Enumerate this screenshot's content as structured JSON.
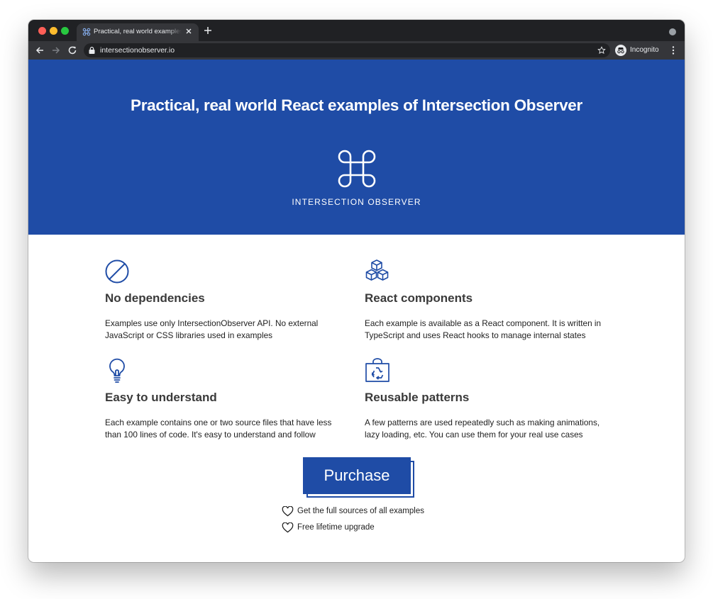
{
  "browser": {
    "tab_title": "Practical, real world examples of Intersection Observer",
    "url": "intersectionobserver.io",
    "profile_label": "Incognito"
  },
  "hero": {
    "title": "Practical, real world React examples of Intersection Observer",
    "logo_text": "INTERSECTION OBSERVER"
  },
  "features": [
    {
      "icon": "no-dependencies-icon",
      "title": "No dependencies",
      "description": "Examples use only IntersectionObserver API. No external JavaScript or CSS libraries used in examples"
    },
    {
      "icon": "react-components-icon",
      "title": "React components",
      "description": "Each example is available as a React component. It is written in TypeScript and uses React hooks to manage internal states"
    },
    {
      "icon": "lightbulb-icon",
      "title": "Easy to understand",
      "description": "Each example contains one or two source files that have less than 100 lines of code. It's easy to understand and follow"
    },
    {
      "icon": "recycle-bag-icon",
      "title": "Reusable patterns",
      "description": "A few patterns are used repeatedly such as making animations, lazy loading, etc. You can use them for your real use cases"
    }
  ],
  "purchase": {
    "button_label": "Purchase",
    "perks": [
      "Get the full sources of all examples",
      "Free lifetime upgrade"
    ]
  },
  "colors": {
    "brand": "#1f4ca6",
    "browser_dark": "#202124",
    "browser_toolbar": "#35363a"
  }
}
